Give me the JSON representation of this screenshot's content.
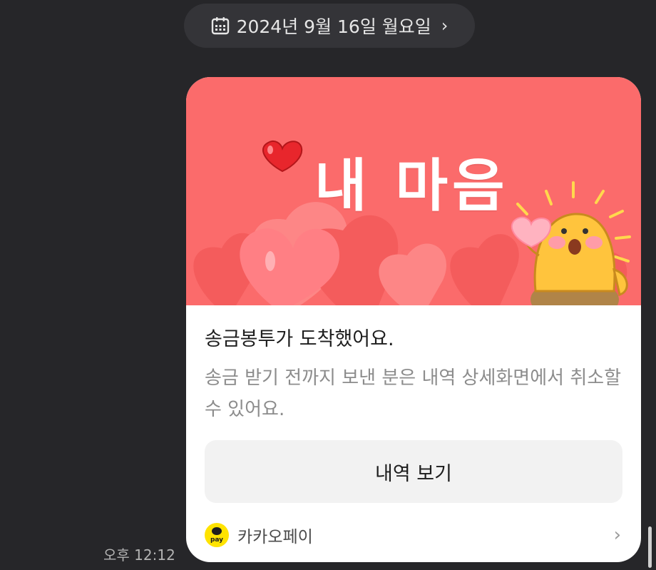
{
  "date_header": {
    "text": "2024년 9월 16일 월요일",
    "chevron": "›",
    "icon": "calendar-icon"
  },
  "message": {
    "time": "오후 12:12",
    "banner_title": "내 마음",
    "title": "송금봉투가 도착했어요.",
    "body": "송금 받기 전까지 보낸 분은 내역 상세화면에서 취소할 수 있어요.",
    "button_label": "내역 보기",
    "footer": {
      "service": "카카오페이",
      "icon_text": "pay",
      "chevron": "›"
    }
  },
  "colors": {
    "background": "#262629",
    "banner": "#fb6b6b",
    "pay_yellow": "#ffe300"
  }
}
